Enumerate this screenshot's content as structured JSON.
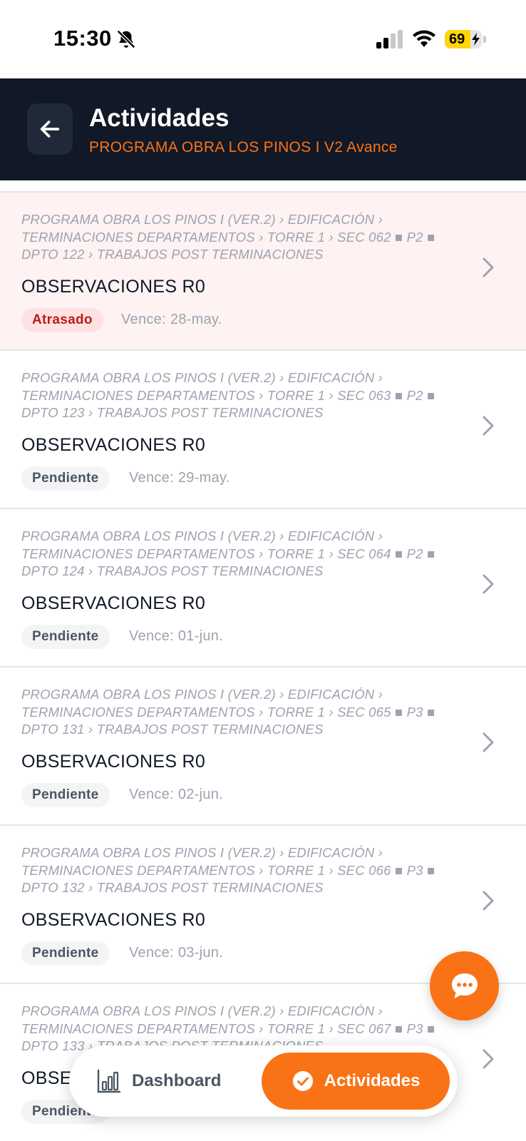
{
  "status_bar": {
    "time": "15:30",
    "battery_level": "69",
    "battery_fraction": 0.69
  },
  "header": {
    "title": "Actividades",
    "subtitle": "PROGRAMA OBRA LOS PINOS I V2 Avance",
    "back_icon": "arrow-left-icon"
  },
  "colors": {
    "accent": "#f97316",
    "header_bg": "#111827",
    "late_bg": "#fef2f2",
    "late_badge_text": "#b91c1c"
  },
  "activities": [
    {
      "breadcrumb": [
        "PROGRAMA OBRA LOS PINOS I (VER.2) › EDIFICACIÓN ›",
        "TERMINACIONES DEPARTAMENTOS › TORRE 1 › SEC 062 ■ P2 ■",
        "DPTO 122 › TRABAJOS POST TERMINACIONES"
      ],
      "title": "OBSERVACIONES R0",
      "status": "Atrasado",
      "due": "Vence: 28-may."
    },
    {
      "breadcrumb": [
        "PROGRAMA OBRA LOS PINOS I (VER.2) › EDIFICACIÓN ›",
        "TERMINACIONES DEPARTAMENTOS › TORRE 1 › SEC 063 ■ P2 ■",
        "DPTO 123 › TRABAJOS POST TERMINACIONES"
      ],
      "title": "OBSERVACIONES R0",
      "status": "Pendiente",
      "due": "Vence: 29-may."
    },
    {
      "breadcrumb": [
        "PROGRAMA OBRA LOS PINOS I (VER.2) › EDIFICACIÓN ›",
        "TERMINACIONES DEPARTAMENTOS › TORRE 1 › SEC 064 ■ P2 ■",
        "DPTO 124 › TRABAJOS POST TERMINACIONES"
      ],
      "title": "OBSERVACIONES R0",
      "status": "Pendiente",
      "due": "Vence: 01-jun."
    },
    {
      "breadcrumb": [
        "PROGRAMA OBRA LOS PINOS I (VER.2) › EDIFICACIÓN ›",
        "TERMINACIONES DEPARTAMENTOS › TORRE 1 › SEC 065 ■ P3 ■",
        "DPTO 131 › TRABAJOS POST TERMINACIONES"
      ],
      "title": "OBSERVACIONES R0",
      "status": "Pendiente",
      "due": "Vence: 02-jun."
    },
    {
      "breadcrumb": [
        "PROGRAMA OBRA LOS PINOS I (VER.2) › EDIFICACIÓN ›",
        "TERMINACIONES DEPARTAMENTOS › TORRE 1 › SEC 066 ■ P3 ■",
        "DPTO 132 › TRABAJOS POST TERMINACIONES"
      ],
      "title": "OBSERVACIONES R0",
      "status": "Pendiente",
      "due": "Vence: 03-jun."
    },
    {
      "breadcrumb": [
        "PROGRAMA OBRA LOS PINOS I (VER.2) › EDIFICACIÓN ›",
        "TERMINACIONES DEPARTAMENTOS › TORRE 1 › SEC 067 ■ P3 ■",
        "DPTO 133 › TRABAJOS POST TERMINACIONES"
      ],
      "title": "OBSERVACIONES R0",
      "status": "Pendiente",
      "due": ""
    }
  ],
  "chat_button": {
    "icon": "chat-bubble-icon"
  },
  "bottom_nav": {
    "dashboard_label": "Dashboard",
    "dashboard_icon": "bar-chart-icon",
    "activities_label": "Actividades",
    "activities_icon": "check-circle-icon",
    "active_tab": "Actividades"
  }
}
